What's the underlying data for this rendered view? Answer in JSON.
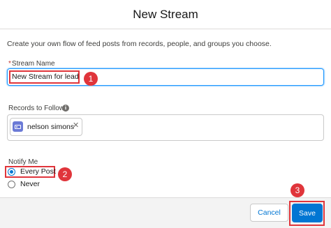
{
  "modal": {
    "title": "New Stream",
    "description": "Create your own flow of feed posts from records, people, and groups you choose."
  },
  "stream_name": {
    "required_marker": "*",
    "label": "Stream Name",
    "value": "New Stream for lead"
  },
  "records_to_follow": {
    "label": "Records to Follow",
    "info_icon": "info-icon",
    "selected": [
      {
        "label": "nelson simons",
        "icon": "contact-card-icon",
        "remove_glyph": "✕"
      }
    ]
  },
  "notify_me": {
    "label": "Notify Me",
    "options": [
      {
        "label": "Every Post",
        "checked": true
      },
      {
        "label": "Never",
        "checked": false
      }
    ]
  },
  "footer": {
    "cancel_label": "Cancel",
    "save_label": "Save"
  },
  "annotations": {
    "step_1": "1",
    "step_2": "2",
    "step_3": "3"
  },
  "colors": {
    "brand_blue": "#0176d3",
    "annotation_red": "#e0353b",
    "pill_icon": "#6b7ad6"
  }
}
